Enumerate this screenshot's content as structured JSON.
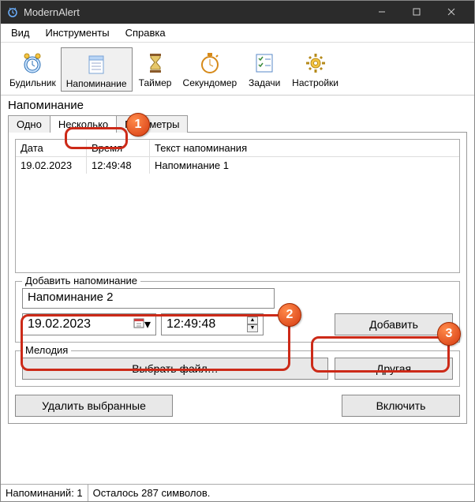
{
  "window": {
    "title": "ModernAlert"
  },
  "menu": {
    "view": "Вид",
    "tools": "Инструменты",
    "help": "Справка"
  },
  "toolbar": {
    "alarm": "Будильник",
    "reminder": "Напоминание",
    "timer": "Таймер",
    "stopwatch": "Секундомер",
    "tasks": "Задачи",
    "settings": "Настройки"
  },
  "section_title": "Напоминание",
  "tabs": {
    "one": "Одно",
    "many": "Несколько",
    "params": "Параметры"
  },
  "list": {
    "headers": {
      "date": "Дата",
      "time": "Время",
      "text": "Текст напоминания"
    },
    "rows": [
      {
        "date": "19.02.2023",
        "time": "12:49:48",
        "text": "Напоминание 1"
      }
    ]
  },
  "add_group": {
    "label": "Добавить напоминание",
    "text_value": "Напоминание 2",
    "date_value": "19.02.2023",
    "time_value": "12:49:48",
    "add_btn": "Добавить"
  },
  "melody": {
    "label": "Мелодия",
    "choose": "Выбрать файл…",
    "other": "Другая"
  },
  "bottom": {
    "delete": "Удалить выбранные",
    "enable": "Включить"
  },
  "status": {
    "count": "Напоминаний: 1",
    "chars": "Осталось 287 символов."
  },
  "annotations": {
    "b1": "1",
    "b2": "2",
    "b3": "3"
  }
}
